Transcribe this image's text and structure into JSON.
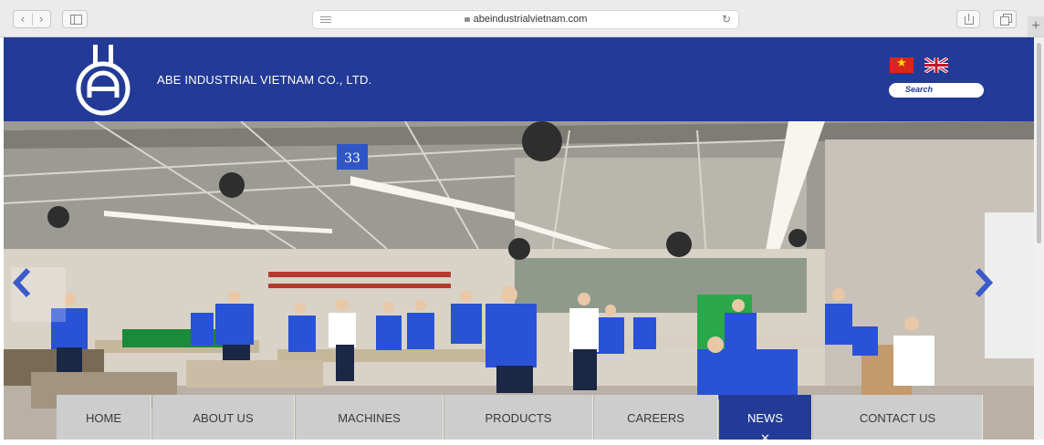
{
  "browser": {
    "url": "abeindustrialvietnam.com",
    "back_icon": "chevron-left-icon",
    "forward_icon": "chevron-right-icon",
    "reload_icon": "reload-icon"
  },
  "header": {
    "company_name": "ABE INDUSTRIAL VIETNAM CO., LTD.",
    "search_placeholder": "Search",
    "languages": [
      "vietnamese-flag",
      "uk-flag"
    ],
    "brand_color": "#233b96"
  },
  "hero": {
    "overlay_sign": "33",
    "prev_icon": "chevron-left-icon",
    "next_icon": "chevron-right-icon"
  },
  "nav": {
    "items": [
      {
        "label": "HOME"
      },
      {
        "label": "ABOUT US"
      },
      {
        "label": "MACHINES"
      },
      {
        "label": "PRODUCTS"
      },
      {
        "label": "CAREERS"
      },
      {
        "label": "NEWS",
        "active": true
      },
      {
        "label": "CONTACT US"
      }
    ],
    "active_marker": "✕"
  }
}
